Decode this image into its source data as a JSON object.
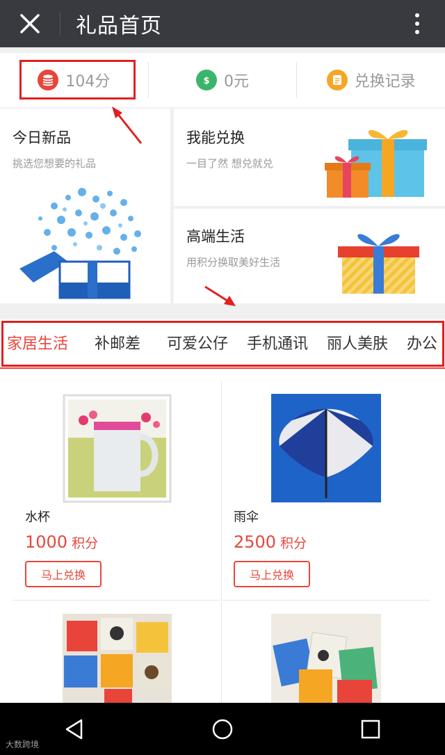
{
  "header": {
    "title": "礼品首页",
    "close_icon": "close-icon",
    "more_icon": "more-vertical-icon"
  },
  "stats": [
    {
      "icon": "points-coin-icon",
      "color": "#e8443a",
      "label": "104分"
    },
    {
      "icon": "money-bag-icon",
      "color": "#3bb56b",
      "label": "0元"
    },
    {
      "icon": "exchange-record-icon",
      "color": "#f5a623",
      "label": "兑换记录"
    }
  ],
  "features": {
    "new": {
      "title": "今日新品",
      "subtitle": "挑选您想要的礼品"
    },
    "can_exchange": {
      "title": "我能兑换",
      "subtitle": "一目了然 想兑就兑"
    },
    "high_end": {
      "title": "高端生活",
      "subtitle": "用积分换取美好生活"
    }
  },
  "categories": [
    "家居生活",
    "补邮差",
    "可爱公仔",
    "手机通讯",
    "丽人美肤",
    "办公"
  ],
  "active_category": "家居生活",
  "products": [
    {
      "name": "水杯",
      "price": "1000",
      "unit": "积分",
      "button": "马上兑换"
    },
    {
      "name": "雨伞",
      "price": "2500",
      "unit": "积分",
      "button": "马上兑换"
    }
  ],
  "watermark": "大数跨境",
  "colors": {
    "accent": "#e9463c",
    "annotation": "#e02020",
    "titlebar": "#383a3f"
  }
}
